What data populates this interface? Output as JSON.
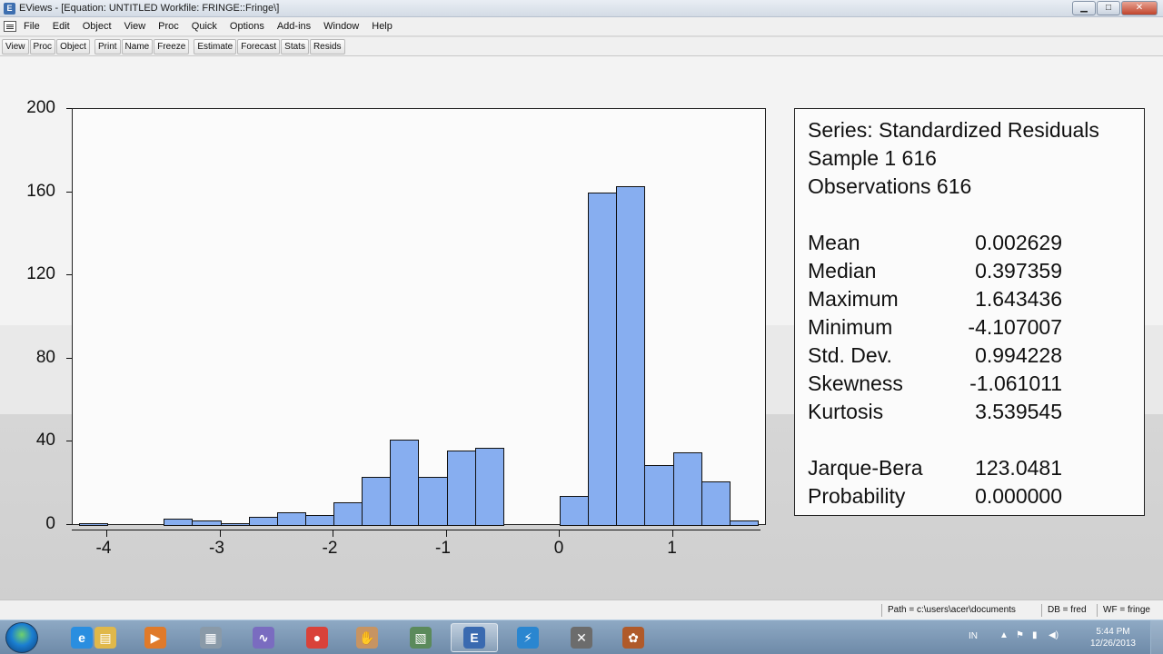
{
  "window": {
    "title": "EViews - [Equation: UNTITLED   Workfile: FRINGE::Fringe\\]",
    "min": "▁",
    "max": "□",
    "close": "✕"
  },
  "menu": [
    "File",
    "Edit",
    "Object",
    "View",
    "Proc",
    "Quick",
    "Options",
    "Add-ins",
    "Window",
    "Help"
  ],
  "toolbar": {
    "group1": [
      "View",
      "Proc",
      "Object"
    ],
    "group2": [
      "Print",
      "Name",
      "Freeze"
    ],
    "group3": [
      "Estimate",
      "Forecast",
      "Stats",
      "Resids"
    ]
  },
  "chart_data": {
    "type": "bar",
    "title": "",
    "xlabel": "",
    "ylabel": "",
    "ylim": [
      0,
      200
    ],
    "yticks": [
      "0",
      "40",
      "80",
      "120",
      "160",
      "200"
    ],
    "xticks": [
      "-4",
      "-3",
      "-2",
      "-1",
      "0",
      "1"
    ],
    "bin_width": 0.25,
    "bins": [
      {
        "start": -4.25,
        "count": 1
      },
      {
        "start": -4.0,
        "count": 0
      },
      {
        "start": -3.75,
        "count": 0
      },
      {
        "start": -3.5,
        "count": 3
      },
      {
        "start": -3.25,
        "count": 2
      },
      {
        "start": -3.0,
        "count": 1
      },
      {
        "start": -2.75,
        "count": 4
      },
      {
        "start": -2.5,
        "count": 6
      },
      {
        "start": -2.25,
        "count": 5
      },
      {
        "start": -2.0,
        "count": 11
      },
      {
        "start": -1.75,
        "count": 23
      },
      {
        "start": -1.5,
        "count": 41
      },
      {
        "start": -1.25,
        "count": 23
      },
      {
        "start": -1.0,
        "count": 36
      },
      {
        "start": -0.75,
        "count": 37
      },
      {
        "start": -0.5,
        "count": 0
      },
      {
        "start": -0.25,
        "count": 0
      },
      {
        "start": 0.0,
        "count": 14
      },
      {
        "start": 0.25,
        "count": 160
      },
      {
        "start": 0.5,
        "count": 163
      },
      {
        "start": 0.75,
        "count": 29
      },
      {
        "start": 1.0,
        "count": 35
      },
      {
        "start": 1.25,
        "count": 21
      },
      {
        "start": 1.5,
        "count": 2
      }
    ]
  },
  "stats": {
    "series": "Series: Standardized Residuals",
    "sample": "Sample 1 616",
    "observations": "Observations 616",
    "rows": [
      {
        "label": "Mean",
        "value": "0.002629"
      },
      {
        "label": "Median",
        "value": "0.397359"
      },
      {
        "label": "Maximum",
        "value": "1.643436"
      },
      {
        "label": "Minimum",
        "value": "-4.107007"
      },
      {
        "label": "Std. Dev.",
        "value": "0.994228"
      },
      {
        "label": "Skewness",
        "value": "-1.061011"
      },
      {
        "label": "Kurtosis",
        "value": "3.539545"
      }
    ],
    "jb_rows": [
      {
        "label": "Jarque-Bera",
        "value": "123.0481"
      },
      {
        "label": "Probability",
        "value": "0.000000"
      }
    ]
  },
  "statusbar": {
    "path": "Path = c:\\users\\acer\\documents",
    "db": "DB = fred",
    "wf": "WF = fringe"
  },
  "taskbar": {
    "apps": [
      {
        "name": "ie-icon",
        "color": "#2a8ee0",
        "glyph": "e"
      },
      {
        "name": "folder-icon",
        "color": "#e0b84a",
        "glyph": "▤"
      },
      {
        "name": "media-player-icon",
        "color": "#e07a2a",
        "glyph": "▶"
      },
      {
        "name": "calculator-icon",
        "color": "#8a9aa8",
        "glyph": "▦"
      },
      {
        "name": "chart-app-icon",
        "color": "#7a6cc0",
        "glyph": "∿"
      },
      {
        "name": "chrome-icon",
        "color": "#d9423a",
        "glyph": "●"
      },
      {
        "name": "hand-app-icon",
        "color": "#c79462",
        "glyph": "✋"
      },
      {
        "name": "calc-tool-icon",
        "color": "#5b8a5b",
        "glyph": "▧"
      },
      {
        "name": "eviews-icon",
        "color": "#3a6ab0",
        "glyph": "E"
      },
      {
        "name": "lightning-icon",
        "color": "#2a86d0",
        "glyph": "⚡"
      },
      {
        "name": "document-icon",
        "color": "#6c6c6c",
        "glyph": "✕"
      },
      {
        "name": "film-reel-icon",
        "color": "#b05a2a",
        "glyph": "✿"
      }
    ],
    "lang": "IN",
    "time": "5:44 PM",
    "date": "12/26/2013"
  }
}
